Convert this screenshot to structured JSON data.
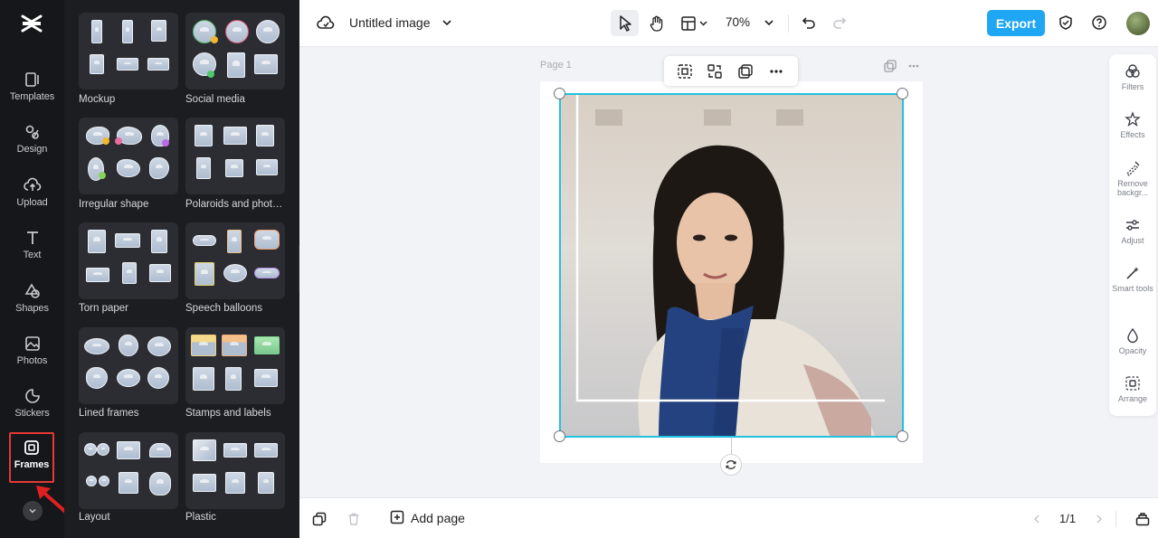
{
  "app": {
    "logo": "capcut-logo-icon"
  },
  "rail": {
    "items": [
      {
        "label": "Templates",
        "icon": "templates-icon"
      },
      {
        "label": "Design",
        "icon": "design-icon"
      },
      {
        "label": "Upload",
        "icon": "upload-icon"
      },
      {
        "label": "Text",
        "icon": "text-icon"
      },
      {
        "label": "Shapes",
        "icon": "shapes-icon"
      },
      {
        "label": "Photos",
        "icon": "photos-icon"
      },
      {
        "label": "Stickers",
        "icon": "stickers-icon"
      },
      {
        "label": "Frames",
        "icon": "frames-icon",
        "active": true
      }
    ]
  },
  "panel": {
    "categories": [
      {
        "label": "Mockup"
      },
      {
        "label": "Social media"
      },
      {
        "label": "Irregular shape"
      },
      {
        "label": "Polaroids and photo f..."
      },
      {
        "label": "Torn paper"
      },
      {
        "label": "Speech balloons"
      },
      {
        "label": "Lined frames"
      },
      {
        "label": "Stamps and labels"
      },
      {
        "label": "Layout"
      },
      {
        "label": "Plastic"
      }
    ]
  },
  "topbar": {
    "title": "Untitled image",
    "zoom": "70%",
    "export_label": "Export"
  },
  "canvas": {
    "page_label": "Page 1"
  },
  "rightpanel": {
    "items": [
      {
        "label": "Filters",
        "icon": "filters-icon"
      },
      {
        "label": "Effects",
        "icon": "effects-icon"
      },
      {
        "label": "Remove backgr...",
        "icon": "remove-background-icon"
      },
      {
        "label": "Adjust",
        "icon": "adjust-icon"
      },
      {
        "label": "Smart tools",
        "icon": "smart-tools-icon"
      },
      {
        "label": "Opacity",
        "icon": "opacity-icon"
      },
      {
        "label": "Arrange",
        "icon": "arrange-icon"
      }
    ]
  },
  "bottombar": {
    "add_page_label": "Add page",
    "page_count": "1/1"
  },
  "colors": {
    "accent": "#1fa7f3",
    "selection": "#22c1df",
    "highlight": "#e53935"
  }
}
